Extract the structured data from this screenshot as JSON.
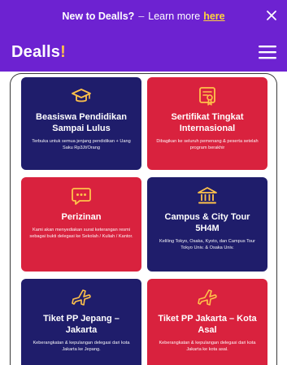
{
  "promo": {
    "strong": "New to Dealls?",
    "dash": "–",
    "text": "Learn more",
    "link": "here",
    "close": "×"
  },
  "header": {
    "brand": "Dealls",
    "brand_mark": "!",
    "menu_icon": "hamburger-menu-icon"
  },
  "colors": {
    "header": "#6d22d1",
    "navy": "#1f1d6b",
    "red": "#d9223e",
    "accent": "#ffc24a"
  },
  "cards": [
    {
      "icon": "graduation-cap-icon",
      "title": "Beasiswa Pendidikan Sampai Lulus",
      "desc": "Terbuka untuk semua jenjang pendidikan + Uang Saku Rp3Jt/Orang"
    },
    {
      "icon": "certificate-icon",
      "title": "Sertifikat Tingkat Internasional",
      "desc": "Dibagikan ke seluruh pemenang & peserta setelah program berakhir"
    },
    {
      "icon": "chat-bubble-icon",
      "title": "Perizinan",
      "desc": "Kami akan menyediakan surat keterangan resmi sebagai bukti delegasi ke Sekolah / Kuliah / Kantor."
    },
    {
      "icon": "university-building-icon",
      "title": "Campus & City Tour 5H4M",
      "desc": "Keliling Tokyo, Osaka, Kyoto, dan Campus Tour Tokyo Univ. & Osaka Univ."
    },
    {
      "icon": "airplane-icon",
      "title": "Tiket PP Jepang – Jakarta",
      "desc": "Keberangkatan & kepulangan delegasi dari kota Jakarta ke Jepang."
    },
    {
      "icon": "airplane-icon",
      "title": "Tiket PP Jakarta – Kota Asal",
      "desc": "Keberangkatan & kepulangan delegasi dari kota Jakarta ke kota asal."
    }
  ]
}
